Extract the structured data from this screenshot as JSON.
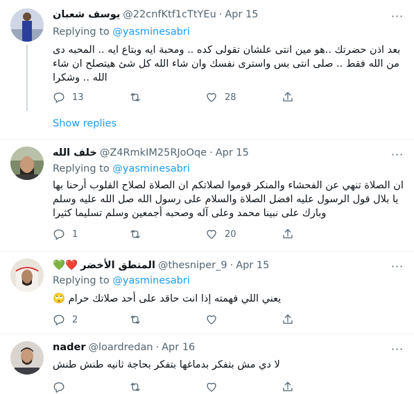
{
  "tweets": [
    {
      "name": "يوسف شعبان",
      "handle": "@22cnfKtf1cTtYEu",
      "date": "Apr 15",
      "replying_prefix": "Replying to",
      "replying_to": "@yasminesabri",
      "text": "بعد اذن حضرتك ..هو مين انتى علشان تقولى كده .. ومحبة ايه وبتاع ايه .. المحبه دى من الله فقط .. صلى انتى بس واسترى نفسك وان شاء الله كل شئ هيتصلح ان شاء الله .. وشكرا",
      "replies": "13",
      "retweets": "",
      "likes": "28",
      "show_replies": "Show replies"
    },
    {
      "name": "خلف الله",
      "handle": "@Z4RmkIM25RJoOqe",
      "date": "Apr 15",
      "replying_prefix": "Replying to",
      "replying_to": "@yasminesabri",
      "text": "ان الصلاة تنهي عن الفحشاء والمنكر قوموا لصلاتكم ان الصلاة لصلاح القلوب أرحنا بها يا بلال قول الرسول عليه افضل الصلاة والسلام على رسول الله صل الله عليه وسلم وبارك على نبينا محمد وعلى آله وصحبه أجمعين وسلم تسليما كثيرا",
      "replies": "1",
      "retweets": "",
      "likes": "20"
    },
    {
      "name": "المنطق الأخضر",
      "name_emoji": "💚❤️",
      "handle": "@thesniper_9",
      "date": "Apr 15",
      "replying_prefix": "Replying to",
      "replying_to": "@yasminesabri",
      "text": "يعني اللي فهمته إذا انت حاقد على أحد صلاتك حرام 🙄",
      "replies": "2",
      "retweets": "",
      "likes": ""
    },
    {
      "name": "nader",
      "handle": "@loardredan",
      "date": "Apr 16",
      "text": "لا دي مش بتفكر بدماغها بتفكر بحاجة ثانيه طنش طنش"
    }
  ],
  "colors": {
    "accent": "#1d9bf0",
    "secondary": "#536471",
    "text": "#0f1419"
  },
  "icons": [
    "reply-icon",
    "retweet-icon",
    "like-icon",
    "share-icon",
    "more-icon"
  ]
}
